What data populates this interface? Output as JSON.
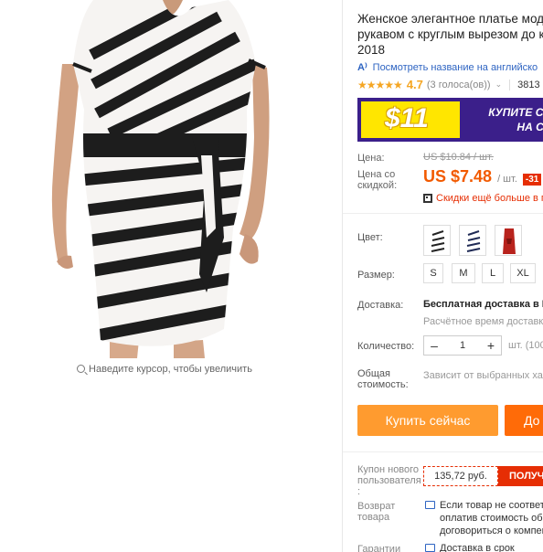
{
  "image": {
    "zoom_hint": "Наведите курсор, чтобы увеличить"
  },
  "product": {
    "title_lines": [
      "Женское элегантное платье модн",
      "рукавом с круглым вырезом до ко",
      "2018"
    ],
    "translate_link": "Посмотреть название на английско",
    "rating": {
      "stars": "★★★★★",
      "value": "4.7",
      "votes": "(3 голоса(ов))",
      "orders": "3813"
    },
    "promo": {
      "amount": "$11",
      "text_line1": "КУПИТЕ СЕЙ",
      "text_line2": "НА СЛЕ"
    },
    "price": {
      "label": "Цена:",
      "old": "US $10.84 / шт.",
      "discount_label_line1": "Цена со",
      "discount_label_line2": "скидкой:",
      "new": "US $7.48",
      "per_unit": "/ шт.",
      "discount_badge": "-31",
      "app_discount": "Скидки ещё больше в п"
    },
    "color": {
      "label": "Цвет:",
      "options": [
        {
          "name": "striped-black-white",
          "primary": "#222222",
          "secondary": "#ffffff"
        },
        {
          "name": "striped-navy-white",
          "primary": "#1f2a55",
          "secondary": "#ffffff"
        },
        {
          "name": "red",
          "primary": "#b8231d",
          "secondary": "#b8231d"
        }
      ]
    },
    "size": {
      "label": "Размер:",
      "options": [
        "S",
        "M",
        "L",
        "XL"
      ]
    },
    "shipping": {
      "label": "Доставка:",
      "title": "Бесплатная доставка в R",
      "estimate": "Расчётное время доставки"
    },
    "quantity": {
      "label": "Количество:",
      "minus": "–",
      "value": "1",
      "plus": "+",
      "units": "шт. (100"
    },
    "total": {
      "label_line1": "Общая",
      "label_line2": "стоимость:",
      "value": "Зависит от выбранных хар"
    },
    "actions": {
      "buy_now": "Купить сейчас",
      "add_to_cart": "До"
    },
    "coupon": {
      "label_line1": "Купон нового",
      "label_line2": "пользователя",
      "label_line3": ":",
      "amount": "135,72 руб.",
      "get": "ПОЛУЧ"
    },
    "returns": {
      "label_line1": "Возврат",
      "label_line2": "товара",
      "line1": "Если товар не соответс",
      "line2": "оплатив стоимость обр",
      "line3": "договориться о компен"
    },
    "guarantees": {
      "label": "Гарантии",
      "line1": "Доставка в срок"
    }
  },
  "colors": {
    "accent_orange": "#ff9b2f",
    "cart_orange": "#ff6b08",
    "price_orange": "#f25a00",
    "link_blue": "#2e64c2",
    "coupon_red": "#e62e04",
    "star_gold": "#f5a623"
  }
}
